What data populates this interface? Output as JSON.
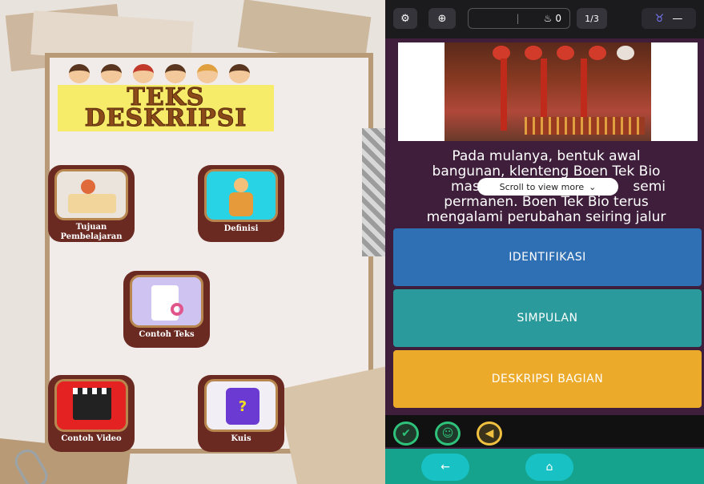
{
  "left": {
    "title_line1": "TEKS",
    "title_line2": "DESKRIPSI",
    "menu": {
      "tujuan": "Tujuan Pembelajaran",
      "definisi": "Definisi",
      "contoh_teks": "Contoh Teks",
      "contoh_video": "Contoh Video",
      "kuis": "Kuis"
    }
  },
  "right": {
    "topbar": {
      "settings_icon": "gear-icon",
      "zoom_icon": "zoom-in-icon",
      "score": "0",
      "progress": "1/3",
      "profile_icon": "taurus-icon",
      "minimize_label": "—"
    },
    "question_text": "Pada mulanya, bentuk awal bangunan, klenteng Boen Tek Bio masih semi permanen. Boen Tek Bio terus mengalami perubahan seiring jalur",
    "q_line1": "Pada mulanya, bentuk awal",
    "q_line2": "bangunan, klenteng Boen Tek Bio",
    "q_line3_left": "masi",
    "q_line3_right": "semi",
    "q_line4": "permanen. Boen Tek Bio terus",
    "q_line5": "mengalami perubahan seiring jalur",
    "scroll_hint": "Scroll to view more",
    "answers": [
      "IDENTIFIKASI",
      "SIMPULAN",
      "DESKRIPSI BAGIAN"
    ],
    "answer_colors": [
      "#2f6fb4",
      "#2a9a9c",
      "#ebaa2a"
    ],
    "powerups": [
      "check-icon",
      "mask-icon",
      "megaphone-icon"
    ],
    "nav": {
      "back_icon": "arrow-left-icon",
      "home_icon": "home-icon"
    }
  }
}
